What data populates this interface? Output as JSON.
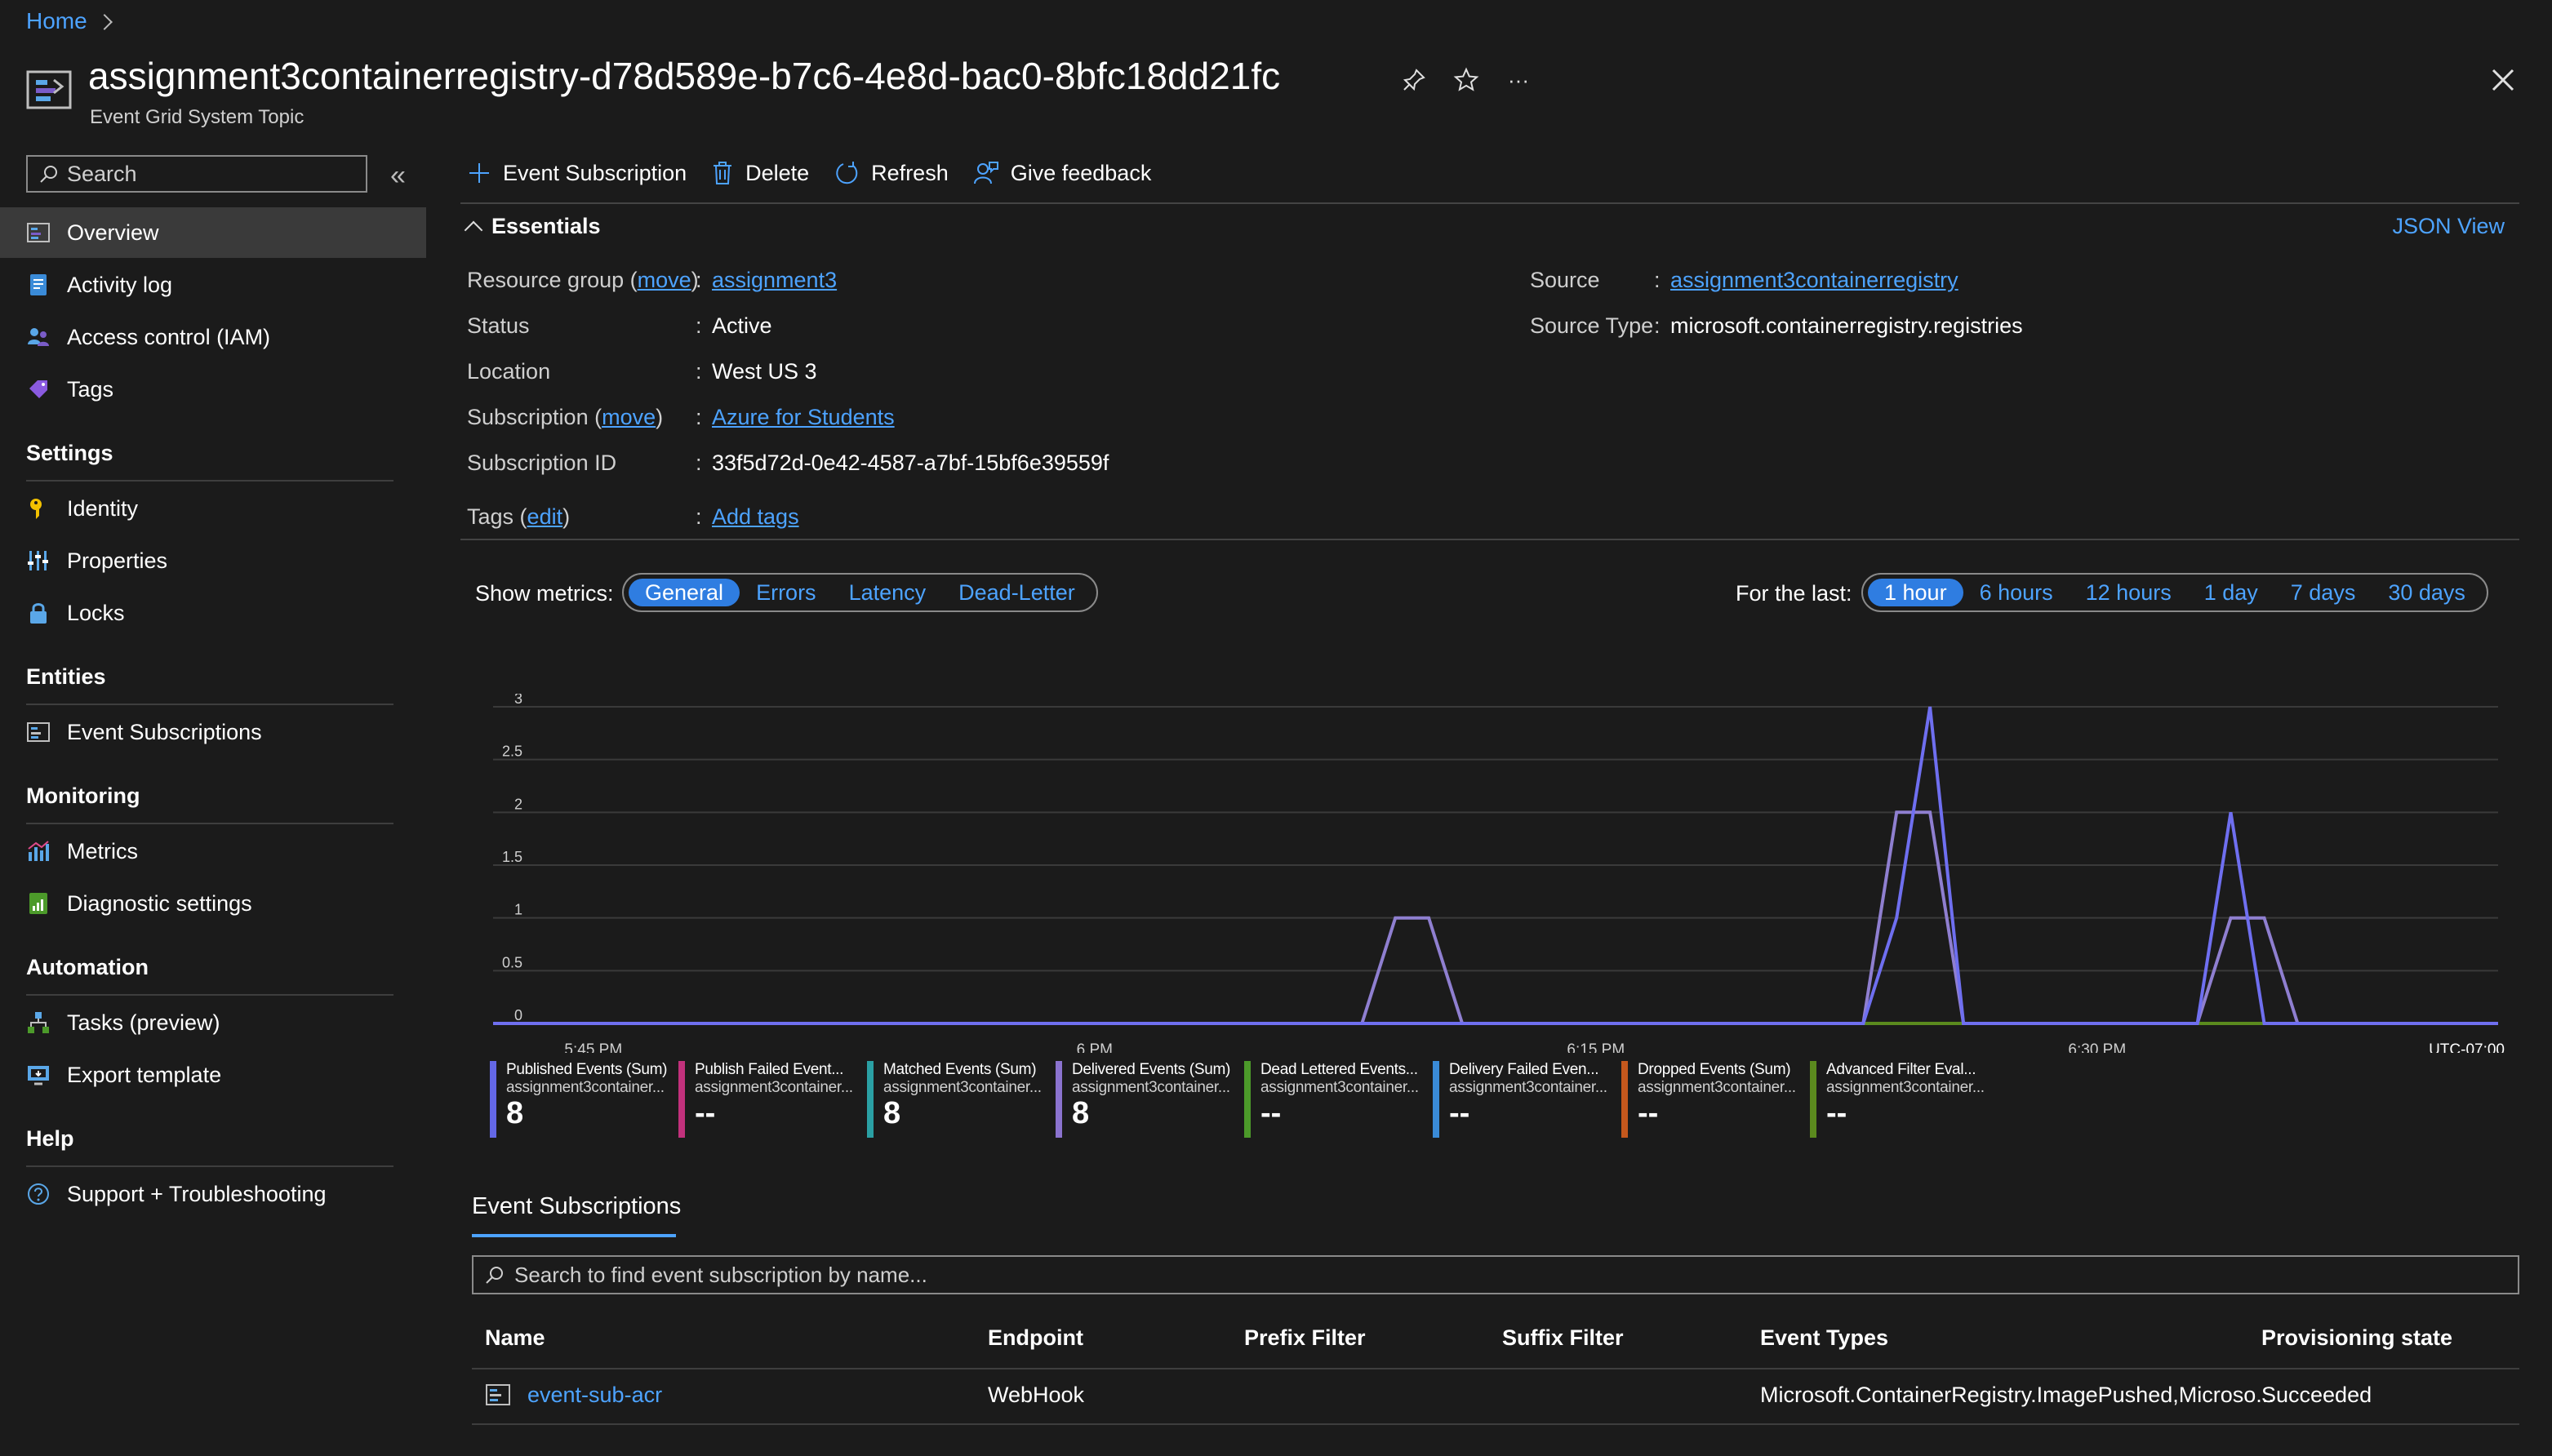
{
  "breadcrumb": {
    "home": "Home"
  },
  "header": {
    "title": "assignment3containerregistry-d78d589e-b7c6-4e8d-bac0-8bfc18dd21fc",
    "subtitle": "Event Grid System Topic",
    "more": "···"
  },
  "sidebar": {
    "search_placeholder": "Search",
    "top_items": [
      {
        "label": "Overview",
        "icon": "overview-icon",
        "active": true
      },
      {
        "label": "Activity log",
        "icon": "activity-log-icon"
      },
      {
        "label": "Access control (IAM)",
        "icon": "people-icon"
      },
      {
        "label": "Tags",
        "icon": "tag-icon"
      }
    ],
    "groups": [
      {
        "title": "Settings",
        "items": [
          {
            "label": "Identity",
            "icon": "identity-icon"
          },
          {
            "label": "Properties",
            "icon": "properties-icon"
          },
          {
            "label": "Locks",
            "icon": "lock-icon"
          }
        ]
      },
      {
        "title": "Entities",
        "items": [
          {
            "label": "Event Subscriptions",
            "icon": "event-subscriptions-icon"
          }
        ]
      },
      {
        "title": "Monitoring",
        "items": [
          {
            "label": "Metrics",
            "icon": "metrics-icon"
          },
          {
            "label": "Diagnostic settings",
            "icon": "diagnostic-icon"
          }
        ]
      },
      {
        "title": "Automation",
        "items": [
          {
            "label": "Tasks (preview)",
            "icon": "tasks-icon"
          },
          {
            "label": "Export template",
            "icon": "export-icon"
          }
        ]
      },
      {
        "title": "Help",
        "items": [
          {
            "label": "Support + Troubleshooting",
            "icon": "support-icon"
          }
        ]
      }
    ]
  },
  "toolbar": {
    "event_subscription": "Event Subscription",
    "delete": "Delete",
    "refresh": "Refresh",
    "feedback": "Give feedback"
  },
  "essentials": {
    "title": "Essentials",
    "json_view": "JSON View",
    "resource_group_label": "Resource group",
    "move": "move",
    "resource_group_value": "assignment3",
    "status_label": "Status",
    "status_value": "Active",
    "location_label": "Location",
    "location_value": "West US 3",
    "subscription_label": "Subscription",
    "subscription_value": "Azure for Students",
    "subscription_id_label": "Subscription ID",
    "subscription_id_value": "33f5d72d-0e42-4587-a7bf-15bf6e39559f",
    "tags_label": "Tags",
    "edit": "edit",
    "tags_value": "Add tags",
    "source_label": "Source",
    "source_value": "assignment3containerregistry",
    "source_type_label": "Source Type",
    "source_type_value": "microsoft.containerregistry.registries",
    "colon": ":"
  },
  "metrics": {
    "show_label": "Show metrics:",
    "tabs": [
      "General",
      "Errors",
      "Latency",
      "Dead-Letter"
    ],
    "selected_tab": "General",
    "for_last_label": "For the last:",
    "ranges": [
      "1 hour",
      "6 hours",
      "12 hours",
      "1 day",
      "7 days",
      "30 days"
    ],
    "selected_range": "1 hour"
  },
  "chart_data": {
    "type": "line",
    "y_ticks": [
      "0",
      "0.5",
      "1",
      "1.5",
      "2",
      "2.5",
      "3"
    ],
    "ylim": [
      0,
      3
    ],
    "x_ticks": [
      "5:45 PM",
      "6 PM",
      "6:15 PM",
      "6:30 PM"
    ],
    "timezone": "UTC-07:00",
    "x_unit_minutes_from_start": "x values are clock times",
    "x": [
      "5:42",
      "5:43",
      "5:44",
      "5:45",
      "5:46",
      "5:47",
      "5:48",
      "5:49",
      "5:50",
      "5:51",
      "5:52",
      "5:53",
      "5:54",
      "5:55",
      "5:56",
      "5:57",
      "5:58",
      "5:59",
      "6:00",
      "6:01",
      "6:02",
      "6:03",
      "6:04",
      "6:05",
      "6:06",
      "6:07",
      "6:08",
      "6:09",
      "6:10",
      "6:11",
      "6:12",
      "6:13",
      "6:14",
      "6:15",
      "6:16",
      "6:17",
      "6:18",
      "6:19",
      "6:20",
      "6:21",
      "6:22",
      "6:23",
      "6:24",
      "6:25",
      "6:26",
      "6:27",
      "6:28",
      "6:29",
      "6:30",
      "6:31",
      "6:32",
      "6:33",
      "6:34",
      "6:35",
      "6:36",
      "6:37",
      "6:38",
      "6:39",
      "6:40",
      "6:41",
      "6:42"
    ],
    "series": [
      {
        "name": "Published Events (Sum)",
        "color": "#6f6ff0",
        "values": [
          0,
          0,
          0,
          0,
          0,
          0,
          0,
          0,
          0,
          0,
          0,
          0,
          0,
          0,
          0,
          0,
          0,
          0,
          0,
          0,
          0,
          0,
          0,
          0,
          0,
          0,
          0,
          0,
          0,
          0,
          0,
          0,
          0,
          0,
          0,
          0,
          0,
          0,
          0,
          0,
          0,
          0,
          1,
          3,
          0,
          0,
          0,
          0,
          0,
          0,
          0,
          0,
          2,
          0,
          0,
          0,
          0,
          0,
          0,
          0,
          0
        ]
      },
      {
        "name": "Delivered Events (Sum)",
        "color": "#8f7fd0",
        "values": [
          0,
          0,
          0,
          0,
          0,
          0,
          0,
          0,
          0,
          0,
          0,
          0,
          0,
          0,
          0,
          0,
          0,
          0,
          0,
          0,
          0,
          0,
          0,
          0,
          0,
          0,
          0,
          1,
          1,
          0,
          0,
          0,
          0,
          0,
          0,
          0,
          0,
          0,
          0,
          0,
          0,
          0,
          2,
          2,
          0,
          0,
          0,
          0,
          0,
          0,
          0,
          0,
          1,
          1,
          0,
          0,
          0,
          0,
          0,
          0,
          0
        ]
      },
      {
        "name": "Advanced Filter Eval...",
        "color": "#5b8a1e",
        "values": [
          0,
          0,
          0,
          0,
          0,
          0,
          0,
          0,
          0,
          0,
          0,
          0,
          0,
          0,
          0,
          0,
          0,
          0,
          0,
          0,
          0,
          0,
          0,
          0,
          0,
          0,
          0,
          0,
          0,
          0,
          0,
          0,
          0,
          0,
          0,
          0,
          0,
          0,
          0,
          0,
          0,
          0,
          0,
          0,
          0,
          0,
          0,
          0,
          0,
          0,
          0,
          0,
          0,
          0,
          0,
          0,
          0,
          0,
          0,
          0,
          0
        ]
      }
    ]
  },
  "legend": [
    {
      "name": "Published Events (Sum)",
      "sub": "assignment3container...",
      "value": "8",
      "color": "#6468e6"
    },
    {
      "name": "Publish Failed Event...",
      "sub": "assignment3container...",
      "value": "--",
      "color": "#c2317c"
    },
    {
      "name": "Matched Events (Sum)",
      "sub": "assignment3container...",
      "value": "8",
      "color": "#2aa0a4"
    },
    {
      "name": "Delivered Events (Sum)",
      "sub": "assignment3container...",
      "value": "8",
      "color": "#8b73cf"
    },
    {
      "name": "Dead Lettered Events...",
      "sub": "assignment3container...",
      "value": "--",
      "color": "#4c9a2a"
    },
    {
      "name": "Delivery Failed Even...",
      "sub": "assignment3container...",
      "value": "--",
      "color": "#3a8bd8"
    },
    {
      "name": "Dropped Events (Sum)",
      "sub": "assignment3container...",
      "value": "--",
      "color": "#c5581d"
    },
    {
      "name": "Advanced Filter Eval...",
      "sub": "assignment3container...",
      "value": "--",
      "color": "#5b8a1e"
    }
  ],
  "subscriptions": {
    "tab": "Event Subscriptions",
    "search_placeholder": "Search to find event subscription by name...",
    "columns": [
      "Name",
      "Endpoint",
      "Prefix Filter",
      "Suffix Filter",
      "Event Types",
      "Provisioning state"
    ],
    "rows": [
      {
        "name": "event-sub-acr",
        "endpoint": "WebHook",
        "prefix": "",
        "suffix": "",
        "event_types": "Microsoft.ContainerRegistry.ImagePushed,Microso...",
        "state": "Succeeded"
      }
    ]
  }
}
